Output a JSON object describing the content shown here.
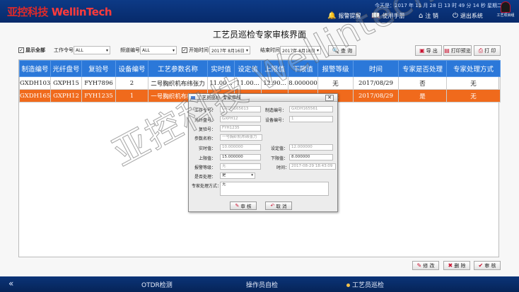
{
  "header": {
    "logo_cn": "亚控科技",
    "logo_en": "WellinTech",
    "datetime": "今天是：2017 年 11 月 28 日 13 时 49 分 14 秒  星期二",
    "buttons": [
      {
        "label": "报警提醒",
        "icon": "bell-icon"
      },
      {
        "label": "使用手册",
        "icon": "book-icon"
      },
      {
        "label": "注 销",
        "icon": "home-icon"
      },
      {
        "label": "退出系统",
        "icon": "power-icon"
      }
    ],
    "user_label": "工艺项目组"
  },
  "title": "工艺员巡检专家审核界面",
  "filters": {
    "show_all": "显示全部",
    "process_no_label": "工作令号：",
    "process_no_value": "ALL",
    "device_no_label": "频道编号：",
    "device_no_value": "ALL",
    "start_label": "开始时间：",
    "start_value": "2017年 8月16日",
    "end_label": "结束时间：",
    "end_value": "2017年 8月18日",
    "query_label": "查 询",
    "export_label": "导 出",
    "preview_label": "打印预览",
    "print_label": "打 印"
  },
  "table": {
    "columns": [
      "制造编号",
      "光纤盘号",
      "复验号",
      "设备编号",
      "工艺参数名称",
      "实时值",
      "设定值",
      "上限值",
      "下限值",
      "报警等级",
      "时间",
      "专家是否处理",
      "专家处理方式"
    ],
    "rows": [
      [
        "GXDH103564",
        "GXPH15",
        "FYH7896",
        "2",
        "二号胸织机布纬张力",
        "11.00...",
        "11.00...",
        "12.90...",
        "8.000000",
        "无",
        "2017/08/29",
        "否",
        "无"
      ],
      [
        "GXDH165561",
        "GXPH12",
        "FYH1235",
        "1",
        "一号胸织机布纬张力",
        "",
        "",
        "",
        "",
        "无",
        "2017/08/29",
        "是",
        "无"
      ]
    ]
  },
  "dialog": {
    "title": "工艺员巡检_专家审核",
    "fields": {
      "work_no_label": "工作令号：",
      "work_no_value": "GXDH165613",
      "make_no_label": "制造编号：",
      "make_no_value": "GXDH165561",
      "fiber_no_label": "光纤盘号：",
      "fiber_no_value": "GXPH12",
      "device_no_label": "设备编号：",
      "device_no_value": "1",
      "recheck_label": "复验号：",
      "recheck_value": "FYH1235",
      "param_label": "参数名称：",
      "param_value": "一号胸织机布纬张力",
      "real_label": "实时值：",
      "real_value": "10.000000",
      "set_label": "设定值：",
      "set_value": "12.000000",
      "upper_label": "上限值：",
      "upper_value": "15.000000",
      "lower_label": "下限值：",
      "lower_value": "8.000000",
      "alarm_label": "报警等级：",
      "alarm_value": "无",
      "time_label": "时间：",
      "time_value": "2017-08-29 18:43:09",
      "handled_label": "是否处理：",
      "handled_value": "是",
      "method_label": "专家处理方式：",
      "method_value": "无"
    },
    "ok_label": "审 核",
    "cancel_label": "取 消"
  },
  "actions": {
    "modify_label": "修 改",
    "delete_label": "删 除",
    "audit_label": "审 核"
  },
  "footer": {
    "nav": [
      "OTDR检测",
      "操作员自检",
      "工艺员巡检"
    ],
    "active": "工艺员巡检"
  },
  "watermark": "亚控科技 Wellintech",
  "colors": {
    "header_bg": "#0d3a86",
    "table_header": "#2b78d9",
    "selected_row": "#f06a1c",
    "accent_red": "#c8102e"
  }
}
